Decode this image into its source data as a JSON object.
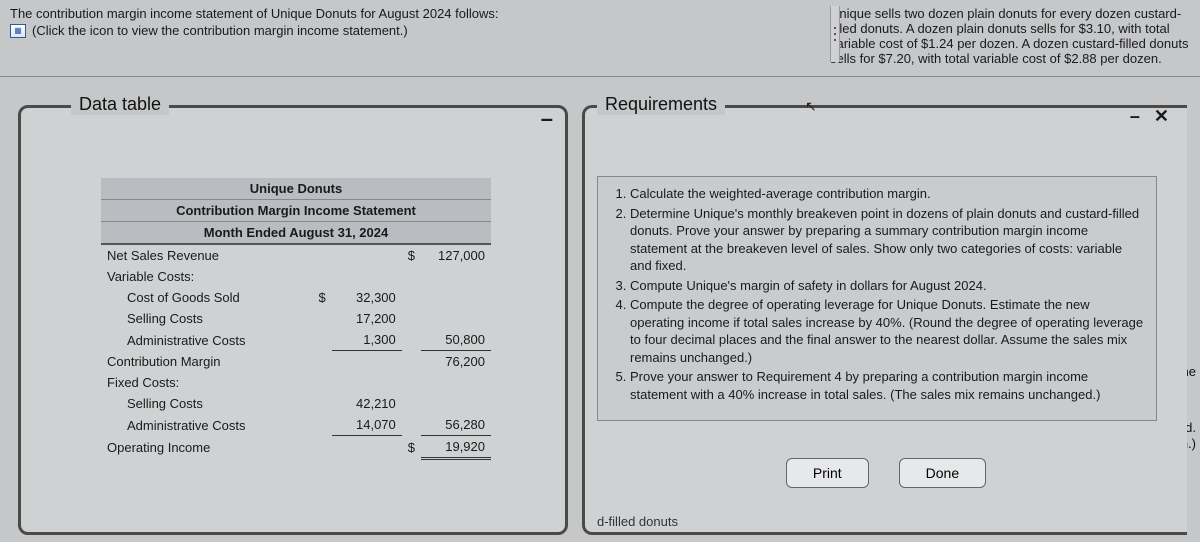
{
  "intro": {
    "line1": "The contribution margin income statement of Unique Donuts for August 2024 follows:",
    "line2": "(Click the icon to view the contribution margin income statement.)"
  },
  "scenario": "Unique sells two dozen plain donuts for every dozen custard-filled donuts. A dozen plain donuts sells for $3.10, with total variable cost of $1.24 per dozen. A dozen custard-filled donuts sells for $7.20, with total variable cost of $2.88 per dozen.",
  "dataPanel": {
    "title": "Data table",
    "minus": "–"
  },
  "reqPanel": {
    "title": "Requirements",
    "minus": "–",
    "close": "✕"
  },
  "stmt": {
    "h1": "Unique Donuts",
    "h2": "Contribution Margin Income Statement",
    "h3": "Month Ended August 31, 2024",
    "rows": {
      "netSales": "Net Sales Revenue",
      "varCosts": "Variable Costs:",
      "cogs": "Cost of Goods Sold",
      "sell": "Selling Costs",
      "admin": "Administrative Costs",
      "cm": "Contribution Margin",
      "fixed": "Fixed Costs:",
      "fsell": "Selling Costs",
      "fadmin": "Administrative Costs",
      "opinc": "Operating Income"
    },
    "vals": {
      "netSales": "127,000",
      "cogs": "32,300",
      "sell": "17,200",
      "admin": "1,300",
      "varTotal": "50,800",
      "cm": "76,200",
      "fsell": "42,210",
      "fadmin": "14,070",
      "fixedTotal": "56,280",
      "opinc": "19,920"
    },
    "dollar": "$"
  },
  "requirements": [
    "Calculate the weighted-average contribution margin.",
    "Determine Unique's monthly breakeven point in dozens of plain donuts and custard-filled donuts. Prove your answer by preparing a summary contribution margin income statement at the breakeven level of sales. Show only two categories of costs: variable and fixed.",
    "Compute Unique's margin of safety in dollars for August 2024.",
    "Compute the degree of operating leverage for Unique Donuts. Estimate the new operating income if total sales increase by 40%. (Round the degree of operating leverage to four decimal places and the final answer to the nearest dollar. Assume the sales mix remains unchanged.)",
    "Prove your answer to Requirement 4 by preparing a contribution margin income statement with a 40% increase in total sales. (The sales mix remains unchanged.)"
  ],
  "buttons": {
    "print": "Print",
    "done": "Done"
  },
  "bg": {
    "t1": "come statement at the",
    "t2": "donuts to be sold.",
    "t3": "gin.)",
    "clip": "d-filled donuts"
  }
}
